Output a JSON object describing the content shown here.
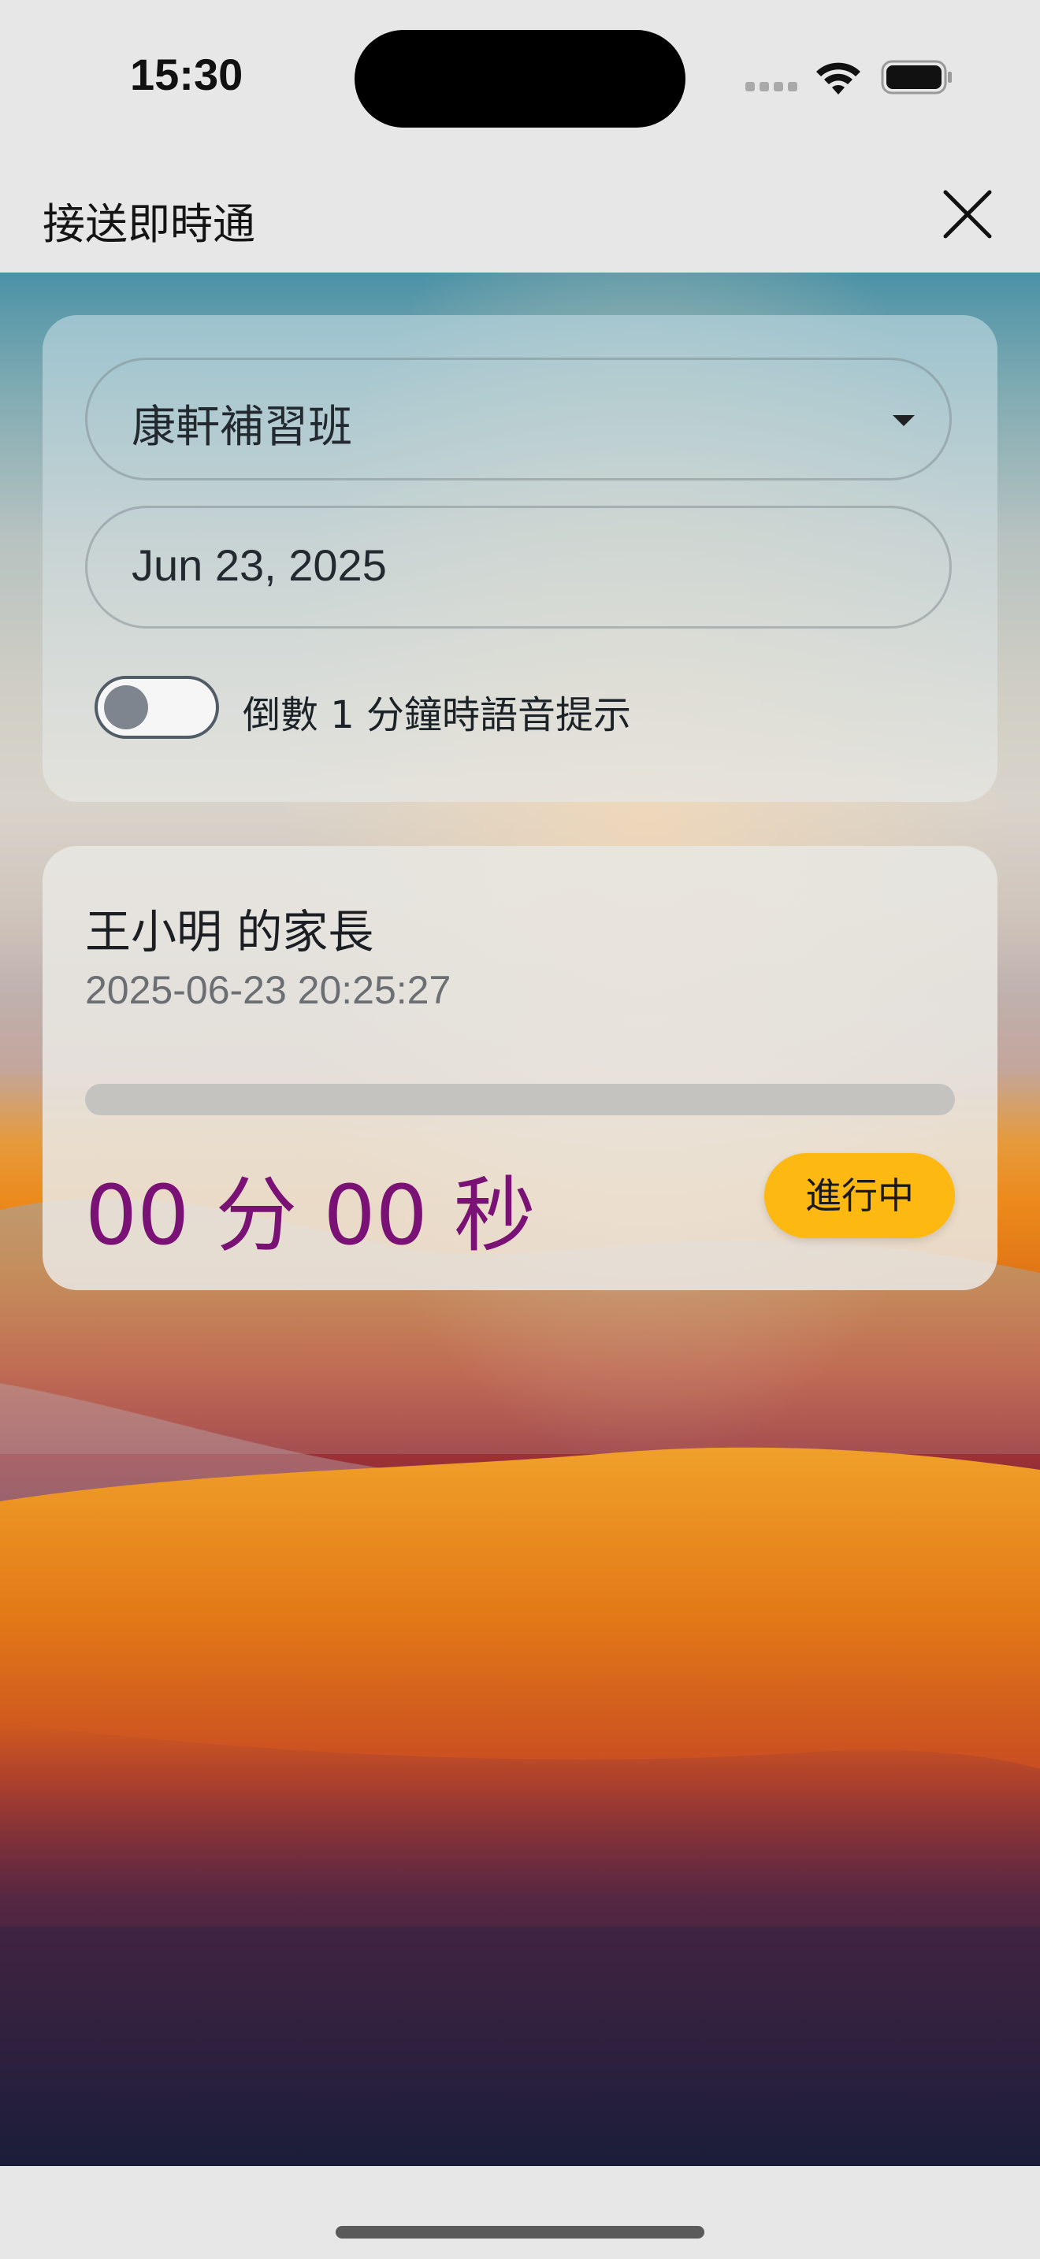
{
  "status_bar": {
    "time": "15:30"
  },
  "header": {
    "title": "接送即時通",
    "close_icon": "close-icon"
  },
  "settings": {
    "school": {
      "selected": "康軒補習班",
      "icon": "chevron-down-icon"
    },
    "date": {
      "value": "Jun 23, 2025"
    },
    "voice_alert": {
      "enabled": false,
      "label": "倒數 1 分鐘時語音提示"
    }
  },
  "pickup": {
    "parent_label": "王小明 的家長",
    "timestamp": "2025-06-23 20:25:27",
    "progress": 0,
    "countdown": "00 分 00 秒",
    "status": "進行中"
  },
  "colors": {
    "countdown": "#7a1174",
    "status_badge": "#fdb812",
    "progress_track": "#c4c3c0"
  }
}
